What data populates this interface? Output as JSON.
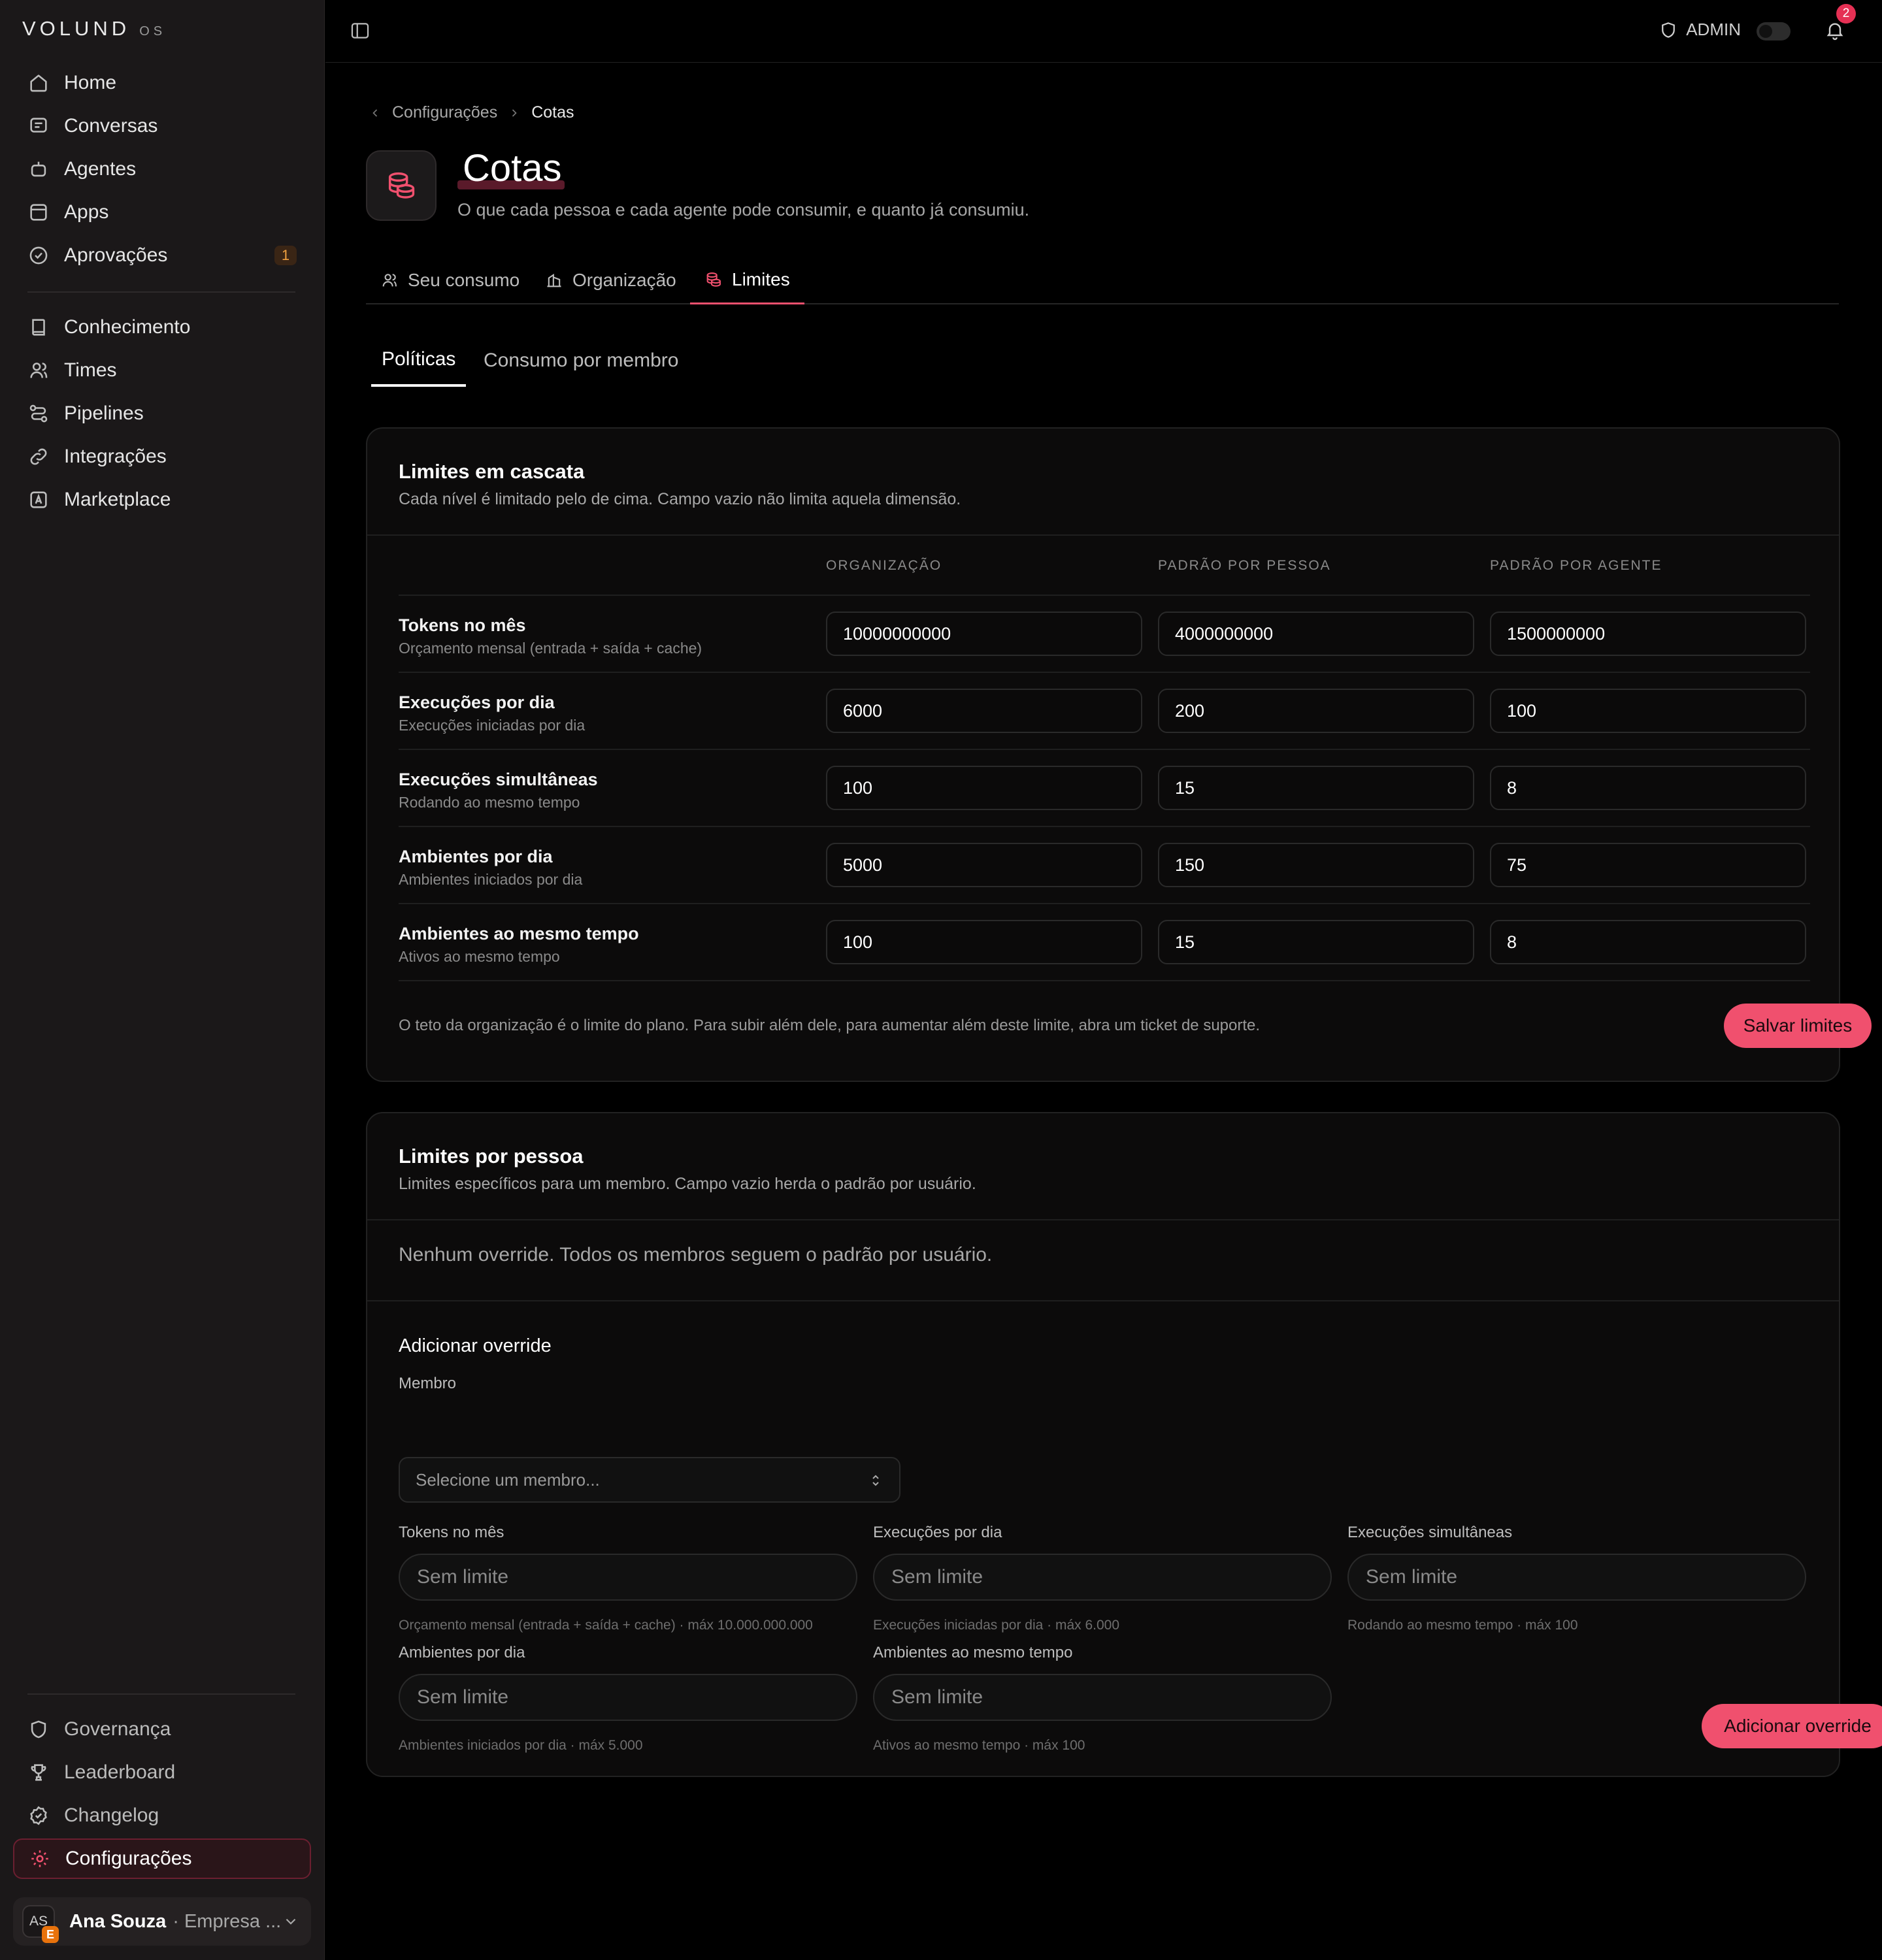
{
  "brand": {
    "name": "VOLUND",
    "suffix": "OS"
  },
  "sidebar": {
    "primary": [
      {
        "label": "Home",
        "icon": "home-icon"
      },
      {
        "label": "Conversas",
        "icon": "chat-icon"
      },
      {
        "label": "Agentes",
        "icon": "bot-icon"
      },
      {
        "label": "Apps",
        "icon": "apps-icon"
      },
      {
        "label": "Aprovações",
        "icon": "check-circle-icon",
        "badge": "1"
      }
    ],
    "secondary": [
      {
        "label": "Conhecimento",
        "icon": "book-icon"
      },
      {
        "label": "Times",
        "icon": "users-icon"
      },
      {
        "label": "Pipelines",
        "icon": "pipeline-icon"
      },
      {
        "label": "Integrações",
        "icon": "link-icon"
      },
      {
        "label": "Marketplace",
        "icon": "store-icon"
      }
    ],
    "bottom": [
      {
        "label": "Governança",
        "icon": "shield-icon"
      },
      {
        "label": "Leaderboard",
        "icon": "trophy-icon"
      },
      {
        "label": "Changelog",
        "icon": "badge-check-icon"
      },
      {
        "label": "Configurações",
        "icon": "gear-icon",
        "active": true
      }
    ],
    "user": {
      "initials": "AS",
      "org_initial": "E",
      "name": "Ana Souza",
      "org": "· Empresa ..."
    }
  },
  "topbar": {
    "role": "ADMIN",
    "notifications": "2"
  },
  "breadcrumb": {
    "parent": "Configurações",
    "current": "Cotas"
  },
  "page": {
    "title": "Cotas",
    "subtitle": "O que cada pessoa e cada agente pode consumir, e quanto já consumiu."
  },
  "tabs": [
    {
      "label": "Seu consumo",
      "icon": "users-icon"
    },
    {
      "label": "Organização",
      "icon": "building-icon"
    },
    {
      "label": "Limites",
      "icon": "coins-icon",
      "active": true
    }
  ],
  "subtabs": [
    {
      "label": "Políticas",
      "active": true
    },
    {
      "label": "Consumo por membro"
    }
  ],
  "cascade": {
    "title": "Limites em cascata",
    "description": "Cada nível é limitado pelo de cima. Campo vazio não limita aquela dimensão.",
    "columns": [
      "ORGANIZAÇÃO",
      "PADRÃO POR PESSOA",
      "PADRÃO POR AGENTE"
    ],
    "rows": [
      {
        "label": "Tokens no mês",
        "hint": "Orçamento mensal (entrada + saída + cache)",
        "values": [
          "10000000000",
          "4000000000",
          "1500000000"
        ]
      },
      {
        "label": "Execuções por dia",
        "hint": "Execuções iniciadas por dia",
        "values": [
          "6000",
          "200",
          "100"
        ]
      },
      {
        "label": "Execuções simultâneas",
        "hint": "Rodando ao mesmo tempo",
        "values": [
          "100",
          "15",
          "8"
        ]
      },
      {
        "label": "Ambientes por dia",
        "hint": "Ambientes iniciados por dia",
        "values": [
          "5000",
          "150",
          "75"
        ]
      },
      {
        "label": "Ambientes ao mesmo tempo",
        "hint": "Ativos ao mesmo tempo",
        "values": [
          "100",
          "15",
          "8"
        ]
      }
    ],
    "footer_note": "O teto da organização é o limite do plano. Para subir além dele, para aumentar além deste limite, abra um ticket de suporte.",
    "save_label": "Salvar limites"
  },
  "per_person": {
    "title": "Limites por pessoa",
    "description": "Limites específicos para um membro. Campo vazio herda o padrão por usuário.",
    "empty": "Nenhum override. Todos os membros seguem o padrão por usuário.",
    "add_title": "Adicionar override",
    "member_label": "Membro",
    "member_placeholder": "Selecione um membro...",
    "fields": [
      {
        "label": "Tokens no mês",
        "placeholder": "Sem limite",
        "hint": "Orçamento mensal (entrada + saída + cache) · máx 10.000.000.000"
      },
      {
        "label": "Execuções por dia",
        "placeholder": "Sem limite",
        "hint": "Execuções iniciadas por dia · máx 6.000"
      },
      {
        "label": "Execuções simultâneas",
        "placeholder": "Sem limite",
        "hint": "Rodando ao mesmo tempo · máx 100"
      },
      {
        "label": "Ambientes por dia",
        "placeholder": "Sem limite",
        "hint": "Ambientes iniciados por dia · máx 5.000"
      },
      {
        "label": "Ambientes ao mesmo tempo",
        "placeholder": "Sem limite",
        "hint": "Ativos ao mesmo tempo · máx 100"
      }
    ],
    "add_label": "Adicionar override"
  },
  "colors": {
    "accent": "#f0506e",
    "background": "#000000",
    "sidebar": "#1b1819",
    "badge": "#e53054"
  }
}
